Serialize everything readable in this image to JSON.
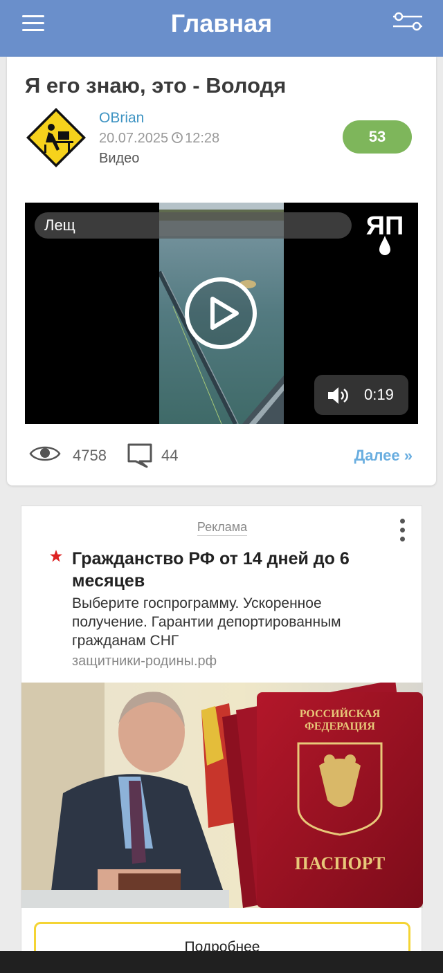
{
  "header": {
    "title": "Главная",
    "menu_icon": "hamburger-menu-icon",
    "filter_icon": "filter-sliders-icon"
  },
  "post": {
    "title": "Я его знаю, это - Володя",
    "author": "OBrian",
    "date": "20.07.2025",
    "time": "12:28",
    "category": "Видео",
    "rating": "53",
    "video": {
      "title": "Лещ",
      "duration": "0:19",
      "logo_text": "ЯП"
    },
    "views": "4758",
    "comments": "44",
    "more_label": "Далее »"
  },
  "ad": {
    "label": "Реклама",
    "headline": "Гражданство РФ от 14 дней до 6 месяцев",
    "description": "Выберите госпрограмму. Ускоренное получение. Гарантии депортированным гражданам СНГ",
    "domain": "защитники-родины.рф",
    "image_text_line1": "РОССИЙСКАЯ",
    "image_text_line2": "ФЕДЕРАЦИЯ",
    "image_text_passport": "ПАСПОРТ",
    "button_label": "Подробнее"
  },
  "colors": {
    "header": "#6a8fcb",
    "accent_link": "#3d93c2",
    "rating_badge": "#7eb65b",
    "ad_button_border": "#f4d434"
  }
}
